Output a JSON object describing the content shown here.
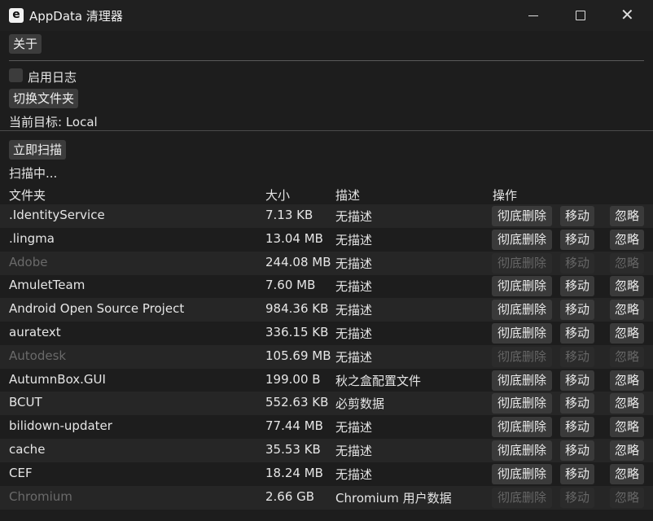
{
  "window": {
    "icon_letter": "e",
    "title": "AppData 清理器",
    "minimize": "minimize",
    "maximize": "maximize",
    "close": "✕"
  },
  "toolbar": {
    "about_label": "关于",
    "enable_log_label": "启用日志",
    "enable_log_checked": false,
    "switch_folder_label": "切换文件夹",
    "current_target": "当前目标: Local",
    "scan_now_label": "立即扫描",
    "scan_status": "扫描中..."
  },
  "table": {
    "headers": {
      "folder": "文件夹",
      "size": "大小",
      "desc": "描述",
      "actions": "操作"
    },
    "action_labels": {
      "delete": "彻底删除",
      "move": "移动",
      "ignore": "忽略"
    },
    "rows": [
      {
        "name": ".IdentityService",
        "size": "7.13 KB",
        "desc": "无描述",
        "enabled": true
      },
      {
        "name": ".lingma",
        "size": "13.04 MB",
        "desc": "无描述",
        "enabled": true
      },
      {
        "name": "Adobe",
        "size": "244.08 MB",
        "desc": "无描述",
        "enabled": false
      },
      {
        "name": "AmuletTeam",
        "size": "7.60 MB",
        "desc": "无描述",
        "enabled": true
      },
      {
        "name": "Android Open Source Project",
        "size": "984.36 KB",
        "desc": "无描述",
        "enabled": true
      },
      {
        "name": "auratext",
        "size": "336.15 KB",
        "desc": "无描述",
        "enabled": true
      },
      {
        "name": "Autodesk",
        "size": "105.69 MB",
        "desc": "无描述",
        "enabled": false
      },
      {
        "name": "AutumnBox.GUI",
        "size": "199.00 B",
        "desc": "秋之盒配置文件",
        "enabled": true
      },
      {
        "name": "BCUT",
        "size": "552.63 KB",
        "desc": "必剪数据",
        "enabled": true
      },
      {
        "name": "bilidown-updater",
        "size": "77.44 MB",
        "desc": "无描述",
        "enabled": true
      },
      {
        "name": "cache",
        "size": "35.53 KB",
        "desc": "无描述",
        "enabled": true
      },
      {
        "name": "CEF",
        "size": "18.24 MB",
        "desc": "无描述",
        "enabled": true
      },
      {
        "name": "Chromium",
        "size": "2.66 GB",
        "desc": "Chromium 用户数据",
        "enabled": false
      }
    ]
  }
}
